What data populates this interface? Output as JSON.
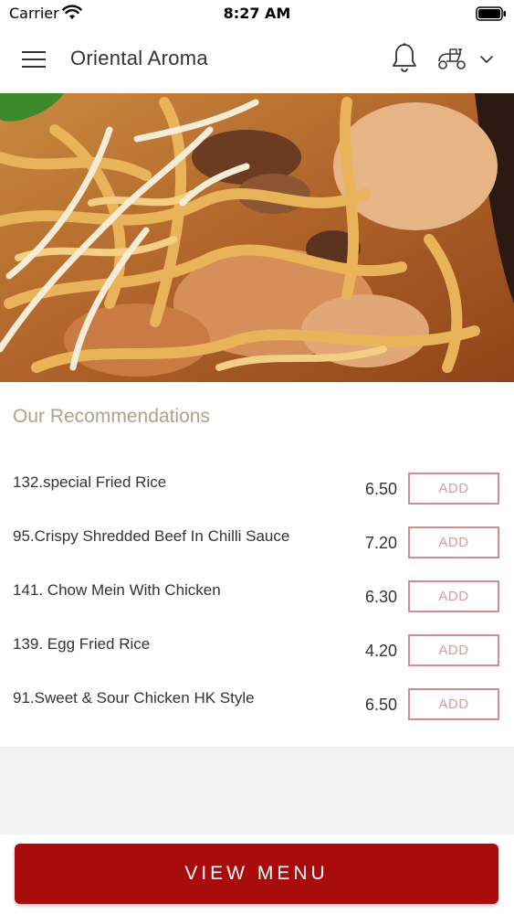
{
  "status_bar": {
    "carrier": "Carrier",
    "time": "8:27 AM"
  },
  "header": {
    "title": "Oriental Aroma"
  },
  "recommendations": {
    "title": "Our Recommendations",
    "items": [
      {
        "name": "132.special Fried Rice",
        "price": "6.50",
        "action": "ADD"
      },
      {
        "name": "95.Crispy Shredded Beef In Chilli Sauce",
        "price": "7.20",
        "action": "ADD"
      },
      {
        "name": "141. Chow Mein With Chicken",
        "price": "6.30",
        "action": "ADD"
      },
      {
        "name": "139. Egg Fried Rice",
        "price": "4.20",
        "action": "ADD"
      },
      {
        "name": "91.Sweet & Sour Chicken HK Style",
        "price": "6.50",
        "action": "ADD"
      }
    ]
  },
  "footer": {
    "view_menu_label": "VIEW MENU"
  },
  "colors": {
    "accent": "#a80c0c",
    "add_border": "#cf8e8e",
    "section_title": "#a8a58a"
  },
  "icons": [
    "wifi-icon",
    "battery-icon",
    "menu-icon",
    "bell-icon",
    "scooter-icon",
    "chevron-down-icon"
  ]
}
